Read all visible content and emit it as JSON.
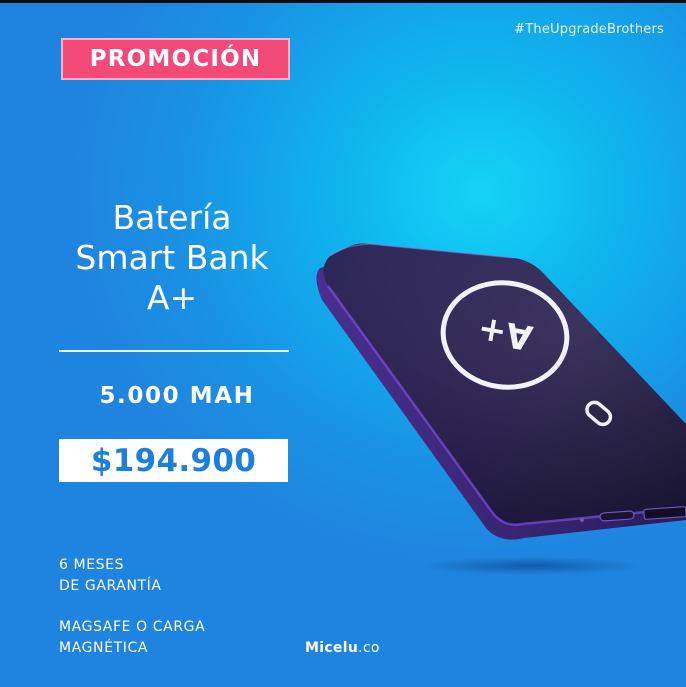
{
  "hashtag": "#TheUpgradeBrothers",
  "promo_badge": "PROMOCIÓN",
  "product": {
    "title_lines": [
      "Batería",
      "Smart Bank",
      "A+"
    ],
    "capacity": "5.000 MAH",
    "price": "$194.900",
    "logo_text": "A+"
  },
  "features": {
    "warranty": [
      "6 MESES",
      "DE GARANTÍA"
    ],
    "charging": [
      "MAGSAFE O CARGA",
      "MAGNÉTICA"
    ]
  },
  "brand": {
    "name": "Micelu",
    "suffix": ".co"
  },
  "colors": {
    "background": "#1f8fe4",
    "glow": "#14d4f6",
    "promo_badge": "#f44a7a",
    "price_text": "#1b7fe0",
    "device": "#2a1f4d"
  },
  "icons": {
    "product": "power-bank-image"
  }
}
